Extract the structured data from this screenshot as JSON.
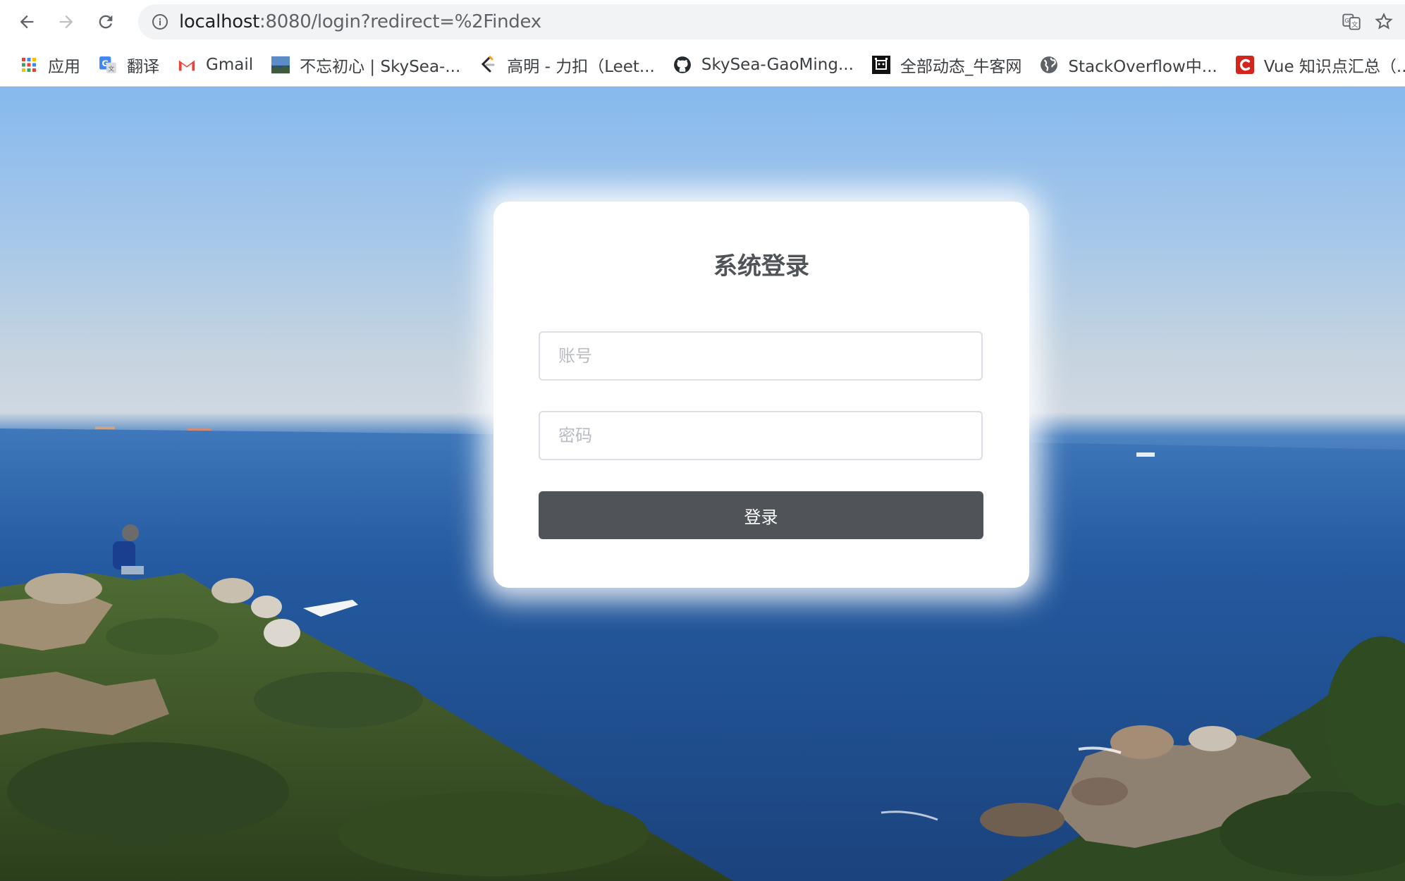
{
  "browser": {
    "url_host": "localhost",
    "url_rest": ":8080/login?redirect=%2Findex",
    "bookmarks": [
      {
        "label": "应用",
        "icon": "apps-grid-icon"
      },
      {
        "label": "翻译",
        "icon": "translate-icon"
      },
      {
        "label": "Gmail",
        "icon": "gmail-icon"
      },
      {
        "label": "不忘初心 | SkySea-...",
        "icon": "landscape-thumbnail-icon"
      },
      {
        "label": "高明 - 力扣（Leet...",
        "icon": "leetcode-icon"
      },
      {
        "label": "SkySea-GaoMing...",
        "icon": "github-icon"
      },
      {
        "label": "全部动态_牛客网",
        "icon": "nowcoder-icon"
      },
      {
        "label": "StackOverflow中...",
        "icon": "globe-icon"
      },
      {
        "label": "Vue 知识点汇总（...",
        "icon": "csdn-icon"
      }
    ]
  },
  "login": {
    "title": "系统登录",
    "account_placeholder": "账号",
    "password_placeholder": "密码",
    "submit_label": "登录"
  },
  "colors": {
    "button": "#505458",
    "title": "#505458",
    "input_border": "#dcdfe6"
  }
}
